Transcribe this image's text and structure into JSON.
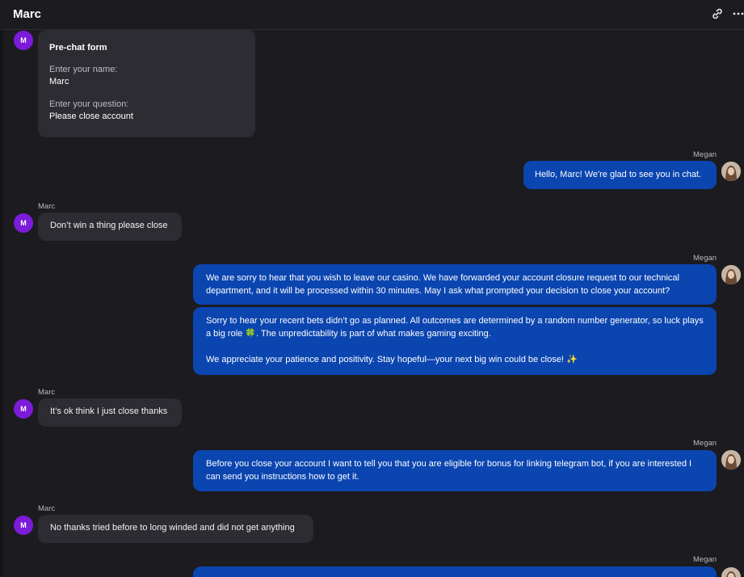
{
  "header": {
    "title": "Marc",
    "link_icon": "link-icon",
    "more_icon": "more-horizontal-icon"
  },
  "colors": {
    "background": "#1c1b1f",
    "incoming_bubble": "#2d2c32",
    "outgoing_bubble": "#0b45b0",
    "user_avatar": "#7c1bd9"
  },
  "user": {
    "initial": "M",
    "name": "Marc"
  },
  "agent": {
    "name": "Megan"
  },
  "prechat": {
    "title": "Pre-chat form",
    "name_label": "Enter your name:",
    "name_value": "Marc",
    "question_label": "Enter your question:",
    "question_value": "Please close account"
  },
  "messages": [
    {
      "text": "Hello, Marc! We're glad to see you in chat."
    },
    {
      "text": "Don’t win a thing please close"
    },
    {
      "text": "We are sorry to hear that you wish to leave our casino. We have forwarded your account closure request to our technical department, and it will be processed within 30 minutes. May I ask what prompted your decision to close your account?"
    },
    {
      "text_1": "Sorry to hear your recent bets didn’t go as planned. All outcomes are determined by a random number generator, so luck plays a big role 🍀. The unpredictability is part of what makes gaming exciting.",
      "text_2": "We appreciate your patience and positivity. Stay hopeful—your next big win could be close! ✨"
    },
    {
      "text": "It’s ok think I just close thanks"
    },
    {
      "text": "Before you close your account I want to tell you that you are eligible for bonus for linking telegram bot, if you are interested I can send you instructions how to get it."
    },
    {
      "text": "No thanks tried before to long winded and did not get anything"
    }
  ]
}
